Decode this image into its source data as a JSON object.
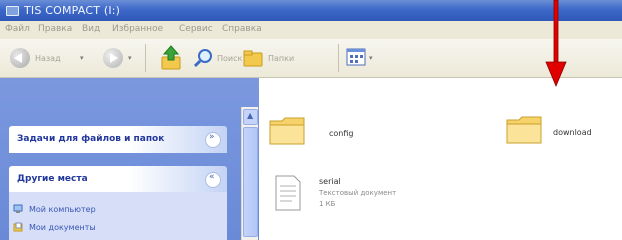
{
  "window": {
    "title": "TIS COMPACT (I:)"
  },
  "menu": {
    "items": [
      "Файл",
      "Правка",
      "Вид",
      "Избранное",
      "Сервис",
      "Справка"
    ]
  },
  "toolbar": {
    "back_label": "Назад",
    "search_label": "Поиск",
    "folders_label": "Папки"
  },
  "sidebar": {
    "tasks_header": "Задачи для файлов и папок",
    "other_places_header": "Другие места",
    "links": [
      "Мой компьютер",
      "Мои документы"
    ]
  },
  "files": [
    {
      "name": "config",
      "kind": "folder"
    },
    {
      "name": "download",
      "kind": "folder"
    },
    {
      "name": "serial",
      "type_text": "Текстовый документ",
      "size_text": "1 КБ",
      "kind": "text"
    }
  ],
  "colors": {
    "annotation_arrow": "#e00000",
    "titlebar": "#3d68c9",
    "sidebar": "#6a8ad7"
  },
  "icons": [
    "back-arrow-icon",
    "forward-arrow-icon",
    "up-folder-icon",
    "search-icon",
    "folders-icon",
    "views-icon",
    "folder-icon",
    "text-document-icon",
    "my-computer-icon",
    "my-documents-icon",
    "annotation-arrow-icon"
  ]
}
